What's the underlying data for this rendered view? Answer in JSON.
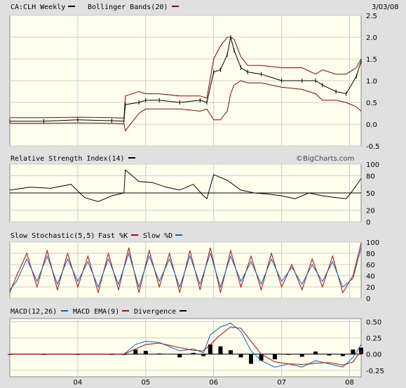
{
  "header": {
    "symbol_label": "CA:CLH Weekly",
    "bb_label": "Bollinger Bands(20)",
    "date": "3/03/08"
  },
  "watermark": "©BigCharts.com",
  "panels": {
    "price": {
      "yticks": [
        "2.5",
        "2.0",
        "1.5",
        "1.0",
        "0.5",
        "0.0",
        "-0.5"
      ]
    },
    "rsi": {
      "title": "Relative Strength Index(14)",
      "yticks": [
        "100",
        "80",
        "50",
        "20",
        "0"
      ]
    },
    "stoch": {
      "title": "Slow Stochastic(5,5)",
      "fast_label": "Fast %K",
      "slow_label": "Slow %D",
      "yticks": [
        "100",
        "80",
        "60",
        "40",
        "20",
        "0"
      ]
    },
    "macd": {
      "title": "MACD(12,26)",
      "macd_label": "MACD EMA(9)",
      "div_label": "Divergence",
      "yticks": [
        "0.50",
        "0.25",
        "0.00",
        "-0.25"
      ]
    }
  },
  "xaxis": {
    "ticks": [
      "04",
      "05",
      "06",
      "07",
      "08"
    ]
  },
  "colors": {
    "background": "#ffffee",
    "frame": "#e0e0e0",
    "price": "#000000",
    "bollinger": "#990000",
    "fast_k": "#cc0000",
    "slow_d": "#0066cc",
    "macd": "#0066cc",
    "ema": "#cc0000",
    "divergence": "#000000"
  },
  "chart_data": [
    {
      "type": "line",
      "title": "CA:CLH Weekly",
      "ylim": [
        -0.5,
        2.5
      ],
      "x": [
        2003.0,
        2003.5,
        2004.0,
        2004.5,
        2004.68,
        2004.7,
        2004.9,
        2005.0,
        2005.2,
        2005.5,
        2005.8,
        2005.9,
        2006.0,
        2006.1,
        2006.2,
        2006.25,
        2006.3,
        2006.4,
        2006.5,
        2006.7,
        2007.0,
        2007.3,
        2007.5,
        2007.6,
        2007.8,
        2007.95,
        2008.1,
        2008.17
      ],
      "series": [
        {
          "name": "CA:CLH Weekly",
          "values": [
            0.07,
            0.07,
            0.1,
            0.08,
            0.07,
            0.45,
            0.5,
            0.55,
            0.55,
            0.5,
            0.55,
            0.5,
            1.2,
            1.25,
            1.6,
            2.0,
            1.7,
            1.3,
            1.2,
            1.15,
            1.0,
            1.0,
            1.0,
            0.9,
            0.75,
            0.7,
            1.1,
            1.45
          ]
        },
        {
          "name": "Bollinger Bands(20) upper",
          "values": [
            0.15,
            0.15,
            0.16,
            0.15,
            0.14,
            0.65,
            0.75,
            0.7,
            0.7,
            0.65,
            0.65,
            0.6,
            1.5,
            1.8,
            2.0,
            2.0,
            1.95,
            1.55,
            1.35,
            1.35,
            1.3,
            1.3,
            1.15,
            1.25,
            1.15,
            1.15,
            1.3,
            1.5
          ]
        },
        {
          "name": "Bollinger Bands(20) lower",
          "values": [
            0.02,
            0.02,
            0.03,
            0.02,
            0.01,
            -0.15,
            0.25,
            0.35,
            0.35,
            0.35,
            0.3,
            0.35,
            0.1,
            0.1,
            0.3,
            0.7,
            0.9,
            1.0,
            0.95,
            0.95,
            0.85,
            0.8,
            0.7,
            0.55,
            0.55,
            0.5,
            0.4,
            0.3
          ]
        }
      ]
    },
    {
      "type": "line",
      "title": "Relative Strength Index(14)",
      "ylim": [
        0,
        100
      ],
      "x": [
        2003.0,
        2003.3,
        2003.6,
        2003.9,
        2004.1,
        2004.3,
        2004.5,
        2004.68,
        2004.7,
        2004.9,
        2005.1,
        2005.3,
        2005.5,
        2005.7,
        2005.85,
        2005.9,
        2006.0,
        2006.2,
        2006.4,
        2006.6,
        2006.8,
        2007.0,
        2007.2,
        2007.4,
        2007.6,
        2007.8,
        2007.95,
        2008.05,
        2008.17
      ],
      "series": [
        {
          "name": "RSI",
          "values": [
            55,
            60,
            58,
            65,
            42,
            35,
            45,
            50,
            90,
            70,
            68,
            60,
            55,
            65,
            45,
            40,
            82,
            72,
            55,
            50,
            48,
            45,
            40,
            50,
            45,
            42,
            40,
            55,
            75
          ]
        }
      ]
    },
    {
      "type": "line",
      "title": "Slow Stochastic(5,5)",
      "ylim": [
        0,
        100
      ],
      "x": [
        2003.0,
        2003.1,
        2003.25,
        2003.4,
        2003.55,
        2003.7,
        2003.85,
        2004.0,
        2004.15,
        2004.3,
        2004.45,
        2004.6,
        2004.75,
        2004.9,
        2005.05,
        2005.2,
        2005.35,
        2005.5,
        2005.65,
        2005.8,
        2005.95,
        2006.1,
        2006.25,
        2006.4,
        2006.55,
        2006.7,
        2006.85,
        2007.0,
        2007.15,
        2007.3,
        2007.45,
        2007.6,
        2007.75,
        2007.9,
        2008.05,
        2008.17
      ],
      "series": [
        {
          "name": "Fast %K",
          "values": [
            10,
            40,
            80,
            20,
            85,
            15,
            80,
            20,
            75,
            10,
            80,
            15,
            90,
            10,
            85,
            20,
            80,
            10,
            85,
            15,
            90,
            10,
            85,
            20,
            75,
            15,
            80,
            20,
            60,
            15,
            70,
            20,
            75,
            10,
            40,
            98
          ]
        },
        {
          "name": "Slow %D",
          "values": [
            15,
            30,
            70,
            30,
            75,
            25,
            70,
            30,
            65,
            20,
            70,
            25,
            80,
            20,
            75,
            30,
            70,
            20,
            75,
            25,
            80,
            20,
            75,
            30,
            65,
            25,
            70,
            30,
            55,
            25,
            60,
            30,
            65,
            20,
            35,
            90
          ]
        }
      ]
    },
    {
      "type": "line",
      "title": "MACD(12,26)",
      "ylim": [
        -0.35,
        0.55
      ],
      "x": [
        2003.0,
        2003.5,
        2004.0,
        2004.5,
        2004.68,
        2004.85,
        2005.0,
        2005.2,
        2005.5,
        2005.7,
        2005.85,
        2005.95,
        2006.1,
        2006.25,
        2006.4,
        2006.55,
        2006.7,
        2006.9,
        2007.1,
        2007.3,
        2007.5,
        2007.7,
        2007.9,
        2008.05,
        2008.17
      ],
      "series": [
        {
          "name": "MACD",
          "values": [
            0.0,
            0.0,
            0.0,
            0.0,
            0.0,
            0.15,
            0.2,
            0.18,
            0.05,
            0.08,
            0.02,
            0.3,
            0.42,
            0.48,
            0.35,
            0.05,
            -0.1,
            -0.2,
            -0.15,
            -0.2,
            -0.1,
            -0.15,
            -0.2,
            -0.05,
            0.15
          ]
        },
        {
          "name": "MACD EMA(9)",
          "values": [
            0.0,
            0.0,
            0.0,
            0.0,
            0.0,
            0.08,
            0.15,
            0.17,
            0.1,
            0.06,
            0.05,
            0.15,
            0.3,
            0.42,
            0.4,
            0.2,
            0.0,
            -0.12,
            -0.15,
            -0.16,
            -0.14,
            -0.13,
            -0.17,
            -0.12,
            0.05
          ]
        },
        {
          "name": "Divergence",
          "values": [
            0.0,
            0.0,
            0.0,
            0.0,
            0.0,
            0.07,
            0.05,
            0.01,
            -0.05,
            0.02,
            -0.03,
            0.15,
            0.12,
            0.06,
            -0.05,
            -0.15,
            -0.1,
            -0.08,
            0.0,
            -0.04,
            0.04,
            -0.02,
            -0.03,
            0.07,
            0.1
          ]
        }
      ]
    }
  ]
}
